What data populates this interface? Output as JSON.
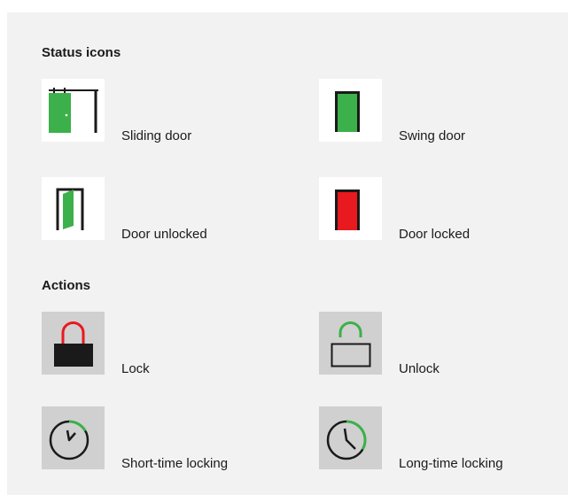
{
  "sections": {
    "status": {
      "title": "Status icons",
      "items": [
        {
          "label": "Sliding door",
          "icon": "sliding-door-icon"
        },
        {
          "label": "Swing door",
          "icon": "swing-door-icon"
        },
        {
          "label": "Door unlocked",
          "icon": "door-unlocked-icon"
        },
        {
          "label": "Door locked",
          "icon": "door-locked-icon"
        }
      ]
    },
    "actions": {
      "title": "Actions",
      "items": [
        {
          "label": "Lock",
          "icon": "padlock-locked-icon"
        },
        {
          "label": "Unlock",
          "icon": "padlock-unlocked-icon"
        },
        {
          "label": "Short-time locking",
          "icon": "short-time-clock-icon"
        },
        {
          "label": "Long-time locking",
          "icon": "long-time-clock-icon"
        }
      ]
    }
  },
  "colors": {
    "panel_bg": "#f2f2f2",
    "status_tile_bg": "#ffffff",
    "action_tile_bg": "#d0d0d0",
    "door_green": "#3cb04a",
    "door_red": "#e8191f",
    "line_dark": "#1a1a1a"
  }
}
